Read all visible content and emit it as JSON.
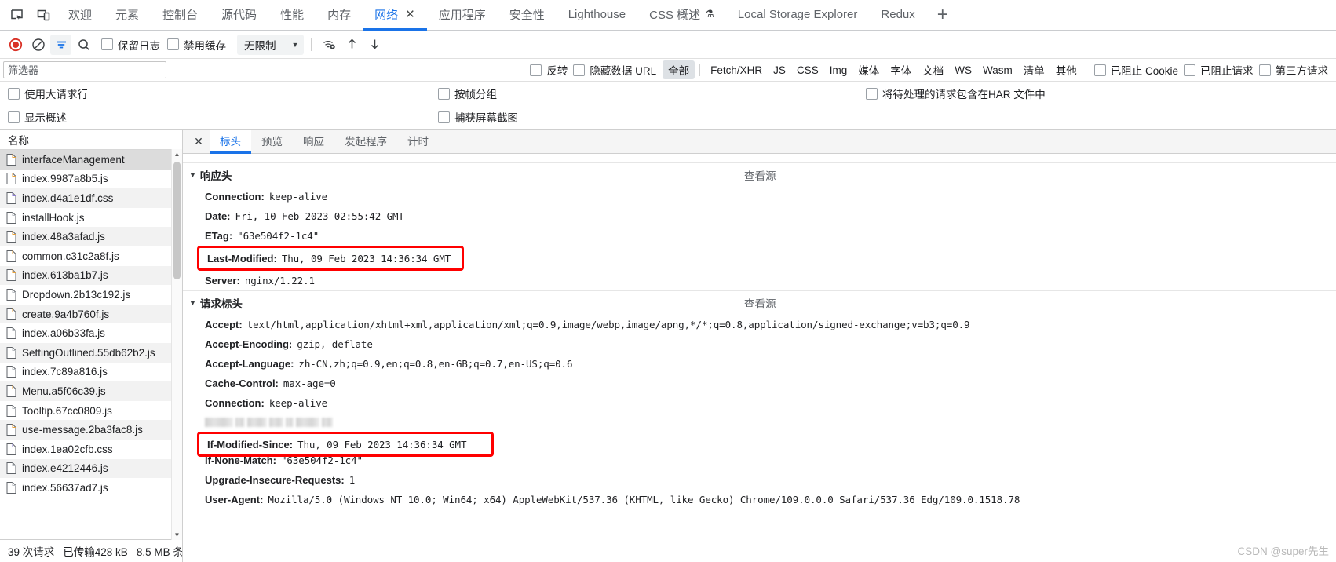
{
  "tabbar": {
    "dock_icons": [
      "inspect-element-icon",
      "device-toolbar-icon"
    ],
    "tabs": [
      {
        "label": "欢迎",
        "active": false
      },
      {
        "label": "元素",
        "active": false
      },
      {
        "label": "控制台",
        "active": false
      },
      {
        "label": "源代码",
        "active": false
      },
      {
        "label": "性能",
        "active": false
      },
      {
        "label": "内存",
        "active": false
      },
      {
        "label": "网络",
        "active": true,
        "closable": true
      },
      {
        "label": "应用程序",
        "active": false
      },
      {
        "label": "安全性",
        "active": false
      },
      {
        "label": "Lighthouse",
        "active": false
      },
      {
        "label": "CSS 概述",
        "active": false,
        "beaker": "⚗"
      },
      {
        "label": "Local Storage Explorer",
        "active": false
      },
      {
        "label": "Redux",
        "active": false
      }
    ],
    "close_glyph": "✕",
    "add_tab_glyph": "+"
  },
  "toolbar": {
    "record_title": "record-button",
    "clear_title": "clear-button",
    "filter_title": "filter-button",
    "search_title": "search-button",
    "preserve_log": "保留日志",
    "disable_cache": "禁用缓存",
    "throttle_value": "无限制",
    "throttle_caret": "▼",
    "network_conditions": "network-conditions-icon",
    "import_har": "import-har-icon",
    "export_har": "export-har-icon"
  },
  "filterbar": {
    "filter_placeholder": "筛选器",
    "filter_value": "",
    "invert": "反转",
    "hide_data_urls": "隐藏数据 URL",
    "types": [
      {
        "label": "全部",
        "active": true
      },
      {
        "label": "Fetch/XHR",
        "active": false
      },
      {
        "label": "JS",
        "active": false
      },
      {
        "label": "CSS",
        "active": false
      },
      {
        "label": "Img",
        "active": false
      },
      {
        "label": "媒体",
        "active": false
      },
      {
        "label": "字体",
        "active": false
      },
      {
        "label": "文档",
        "active": false
      },
      {
        "label": "WS",
        "active": false
      },
      {
        "label": "Wasm",
        "active": false
      },
      {
        "label": "清单",
        "active": false
      },
      {
        "label": "其他",
        "active": false
      }
    ],
    "blocked_cookies": "已阻止 Cookie",
    "blocked_requests": "已阻止请求",
    "third_party": "第三方请求"
  },
  "options": {
    "big_request_rows": "使用大请求行",
    "group_by_frame": "按帧分组",
    "include_har": "将待处理的请求包含在HAR 文件中",
    "show_overview": "显示概述",
    "capture_screenshots": "捕获屏幕截图"
  },
  "requests": {
    "column_header": "名称",
    "items": [
      {
        "name": "interfaceManagement",
        "type": "doc",
        "selected": true
      },
      {
        "name": "index.9987a8b5.js",
        "type": "js"
      },
      {
        "name": "index.d4a1e1df.css",
        "type": "css"
      },
      {
        "name": "installHook.js",
        "type": "js"
      },
      {
        "name": "index.48a3afad.js",
        "type": "js"
      },
      {
        "name": "common.c31c2a8f.js",
        "type": "js"
      },
      {
        "name": "index.613ba1b7.js",
        "type": "js"
      },
      {
        "name": "Dropdown.2b13c192.js",
        "type": "js"
      },
      {
        "name": "create.9a4b760f.js",
        "type": "js"
      },
      {
        "name": "index.a06b33fa.js",
        "type": "js"
      },
      {
        "name": "SettingOutlined.55db62b2.js",
        "type": "js"
      },
      {
        "name": "index.7c89a816.js",
        "type": "js"
      },
      {
        "name": "Menu.a5f06c39.js",
        "type": "js"
      },
      {
        "name": "Tooltip.67cc0809.js",
        "type": "js"
      },
      {
        "name": "use-message.2ba3fac8.js",
        "type": "js"
      },
      {
        "name": "index.1ea02cfb.css",
        "type": "css"
      },
      {
        "name": "index.e4212446.js",
        "type": "js"
      },
      {
        "name": "index.56637ad7.js",
        "type": "js"
      }
    ],
    "scroll_up_glyph": "▲",
    "scroll_down_glyph": "▼"
  },
  "statusbar": {
    "requests": "39 次请求",
    "transferred": "已传输428 kB",
    "resources": "8.5 MB 条"
  },
  "detail": {
    "close_glyph": "✕",
    "tabs": [
      {
        "label": "标头",
        "active": true
      },
      {
        "label": "预览",
        "active": false
      },
      {
        "label": "响应",
        "active": false
      },
      {
        "label": "发起程序",
        "active": false
      },
      {
        "label": "计时",
        "active": false
      }
    ],
    "view_source": "查看源",
    "triangle": "▼",
    "response_section": {
      "title": "响应头",
      "view_source": "查看源",
      "headers": [
        {
          "name": "Connection:",
          "value": "keep-alive",
          "boxed": false
        },
        {
          "name": "Date:",
          "value": "Fri, 10 Feb 2023 02:55:42 GMT",
          "boxed": false
        },
        {
          "name": "ETag:",
          "value": "\"63e504f2-1c4\"",
          "boxed": false
        },
        {
          "name": "Last-Modified:",
          "value": "Thu, 09 Feb 2023 14:36:34 GMT",
          "boxed": true
        },
        {
          "name": "Server:",
          "value": "nginx/1.22.1",
          "boxed": false
        }
      ]
    },
    "request_section": {
      "title": "请求标头",
      "view_source": "查看源",
      "headers": [
        {
          "name": "Accept:",
          "value": "text/html,application/xhtml+xml,application/xml;q=0.9,image/webp,image/apng,*/*;q=0.8,application/signed-exchange;v=b3;q=0.9",
          "boxed": false
        },
        {
          "name": "Accept-Encoding:",
          "value": "gzip, deflate",
          "boxed": false
        },
        {
          "name": "Accept-Language:",
          "value": "zh-CN,zh;q=0.9,en;q=0.8,en-GB;q=0.7,en-US;q=0.6",
          "boxed": false
        },
        {
          "name": "Cache-Control:",
          "value": "max-age=0",
          "boxed": false
        },
        {
          "name": "Connection:",
          "value": "keep-alive",
          "boxed": false
        },
        {
          "name": "",
          "value": "",
          "redacted": true
        },
        {
          "name": "If-Modified-Since:",
          "value": "Thu, 09 Feb 2023 14:36:34 GMT",
          "boxed": true
        },
        {
          "name": "If-None-Match:",
          "value": "\"63e504f2-1c4\"",
          "boxed": false
        },
        {
          "name": "Upgrade-Insecure-Requests:",
          "value": "1",
          "boxed": false
        },
        {
          "name": "User-Agent:",
          "value": "Mozilla/5.0 (Windows NT 10.0; Win64; x64) AppleWebKit/537.36 (KHTML, like Gecko) Chrome/109.0.0.0 Safari/537.36 Edg/109.0.1518.78",
          "boxed": false
        }
      ]
    }
  },
  "watermark": "CSDN @super先生",
  "colors": {
    "accent": "#1a73e8",
    "record": "#d93025",
    "highlight_box": "#ff0000",
    "selected_row": "#dcdcdc"
  }
}
